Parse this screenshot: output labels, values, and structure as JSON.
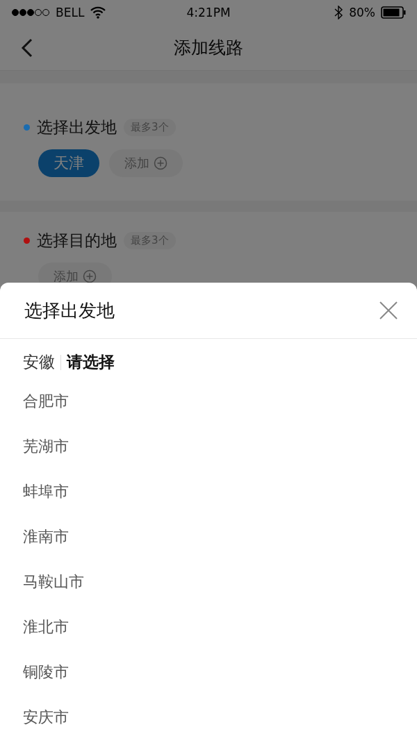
{
  "status_bar": {
    "carrier": "BELL",
    "time": "4:21PM",
    "battery": "80%"
  },
  "nav": {
    "title": "添加线路"
  },
  "sections": [
    {
      "title": "选择出发地",
      "hint": "最多3个",
      "color": "#1a6cb0",
      "chips": [
        {
          "label": "天津",
          "selected": true
        },
        {
          "label": "添加",
          "selected": false,
          "kind": "add"
        }
      ]
    },
    {
      "title": "选择目的地",
      "hint": "最多3个",
      "color": "#b01010",
      "chips": [
        {
          "label": "添加",
          "selected": false,
          "kind": "add"
        }
      ]
    }
  ],
  "sheet": {
    "title": "选择出发地",
    "tabs": [
      {
        "label": "安徽",
        "selected": false
      },
      {
        "label": "请选择",
        "selected": true
      }
    ],
    "items": [
      "合肥市",
      "芜湖市",
      "蚌埠市",
      "淮南市",
      "马鞍山市",
      "淮北市",
      "铜陵市",
      "安庆市"
    ]
  }
}
